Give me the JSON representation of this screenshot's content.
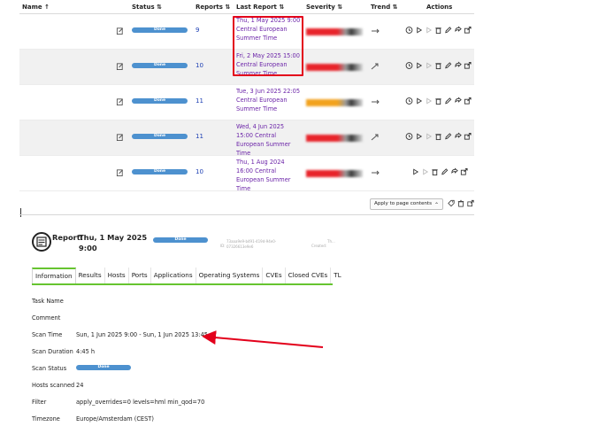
{
  "table": {
    "columns": {
      "name": "Name ↑",
      "status": "Status ⇅",
      "reports": "Reports ⇅",
      "last_report": "Last Report ⇅",
      "severity": "Severity ⇅",
      "trend": "Trend ⇅",
      "actions": "Actions"
    },
    "rows": [
      {
        "status": "Done",
        "reports": "9",
        "last_report": "Thu, 1 May 2025 9:00 Central European Summer Time",
        "severity_color": "#e8232a",
        "actions_count": 6
      },
      {
        "status": "Done",
        "reports": "10",
        "last_report": "Fri, 2 May 2025 15:00 Central European Summer Time",
        "severity_color": "#e8232a",
        "actions_count": 6
      },
      {
        "status": "Done",
        "reports": "11",
        "last_report": "Tue, 3 Jun 2025 22:05 Central European Summer Time",
        "severity_color": "#f2a21d",
        "actions_count": 6
      },
      {
        "status": "Done",
        "reports": "11",
        "last_report": "Wed, 4 Jun 2025 15:00 Central European Summer Time",
        "severity_color": "#e8232a",
        "actions_count": 6
      },
      {
        "status": "Done",
        "reports": "10",
        "last_report": "Thu, 1 Aug 2024 16:00 Central European Summer Time",
        "severity_color": "#e8232a",
        "actions_count": 5
      }
    ],
    "apply_select": "Apply to page contents"
  },
  "report": {
    "heading": "Report:",
    "date": "Thu, 1 May 2025 9:00",
    "status": "Done",
    "id_label": "ID:",
    "id_value": "73aaa9e9-b491-419d-94e0-07326613e9e6",
    "created_label": "Created:",
    "created_value": "Th..."
  },
  "tabs": [
    "Information",
    "Results",
    "Hosts",
    "Ports",
    "Applications",
    "Operating Systems",
    "CVEs",
    "Closed CVEs",
    "TL"
  ],
  "info": {
    "task_name_label": "Task Name",
    "task_name_value": "",
    "comment_label": "Comment",
    "comment_value": "",
    "scan_time_label": "Scan Time",
    "scan_time_value": "Sun, 1 Jun 2025 9:00 - Sun, 1 Jun 2025 13:45",
    "scan_duration_label": "Scan Duration",
    "scan_duration_value": "4:45 h",
    "scan_status_label": "Scan Status",
    "scan_status_value": "Done",
    "hosts_scanned_label": "Hosts scanned",
    "hosts_scanned_value": "24",
    "filter_label": "Filter",
    "filter_value": "apply_overrides=0 levels=hml min_qod=70",
    "timezone_label": "Timezone",
    "timezone_value": "Europe/Amsterdam (CEST)"
  },
  "colors": {
    "status_blue": "#4d91cf",
    "link_blue": "#1d3fb3",
    "last_report_purple": "#6b24a8",
    "highlight_red": "#e3001b",
    "tab_green": "#66c430"
  }
}
